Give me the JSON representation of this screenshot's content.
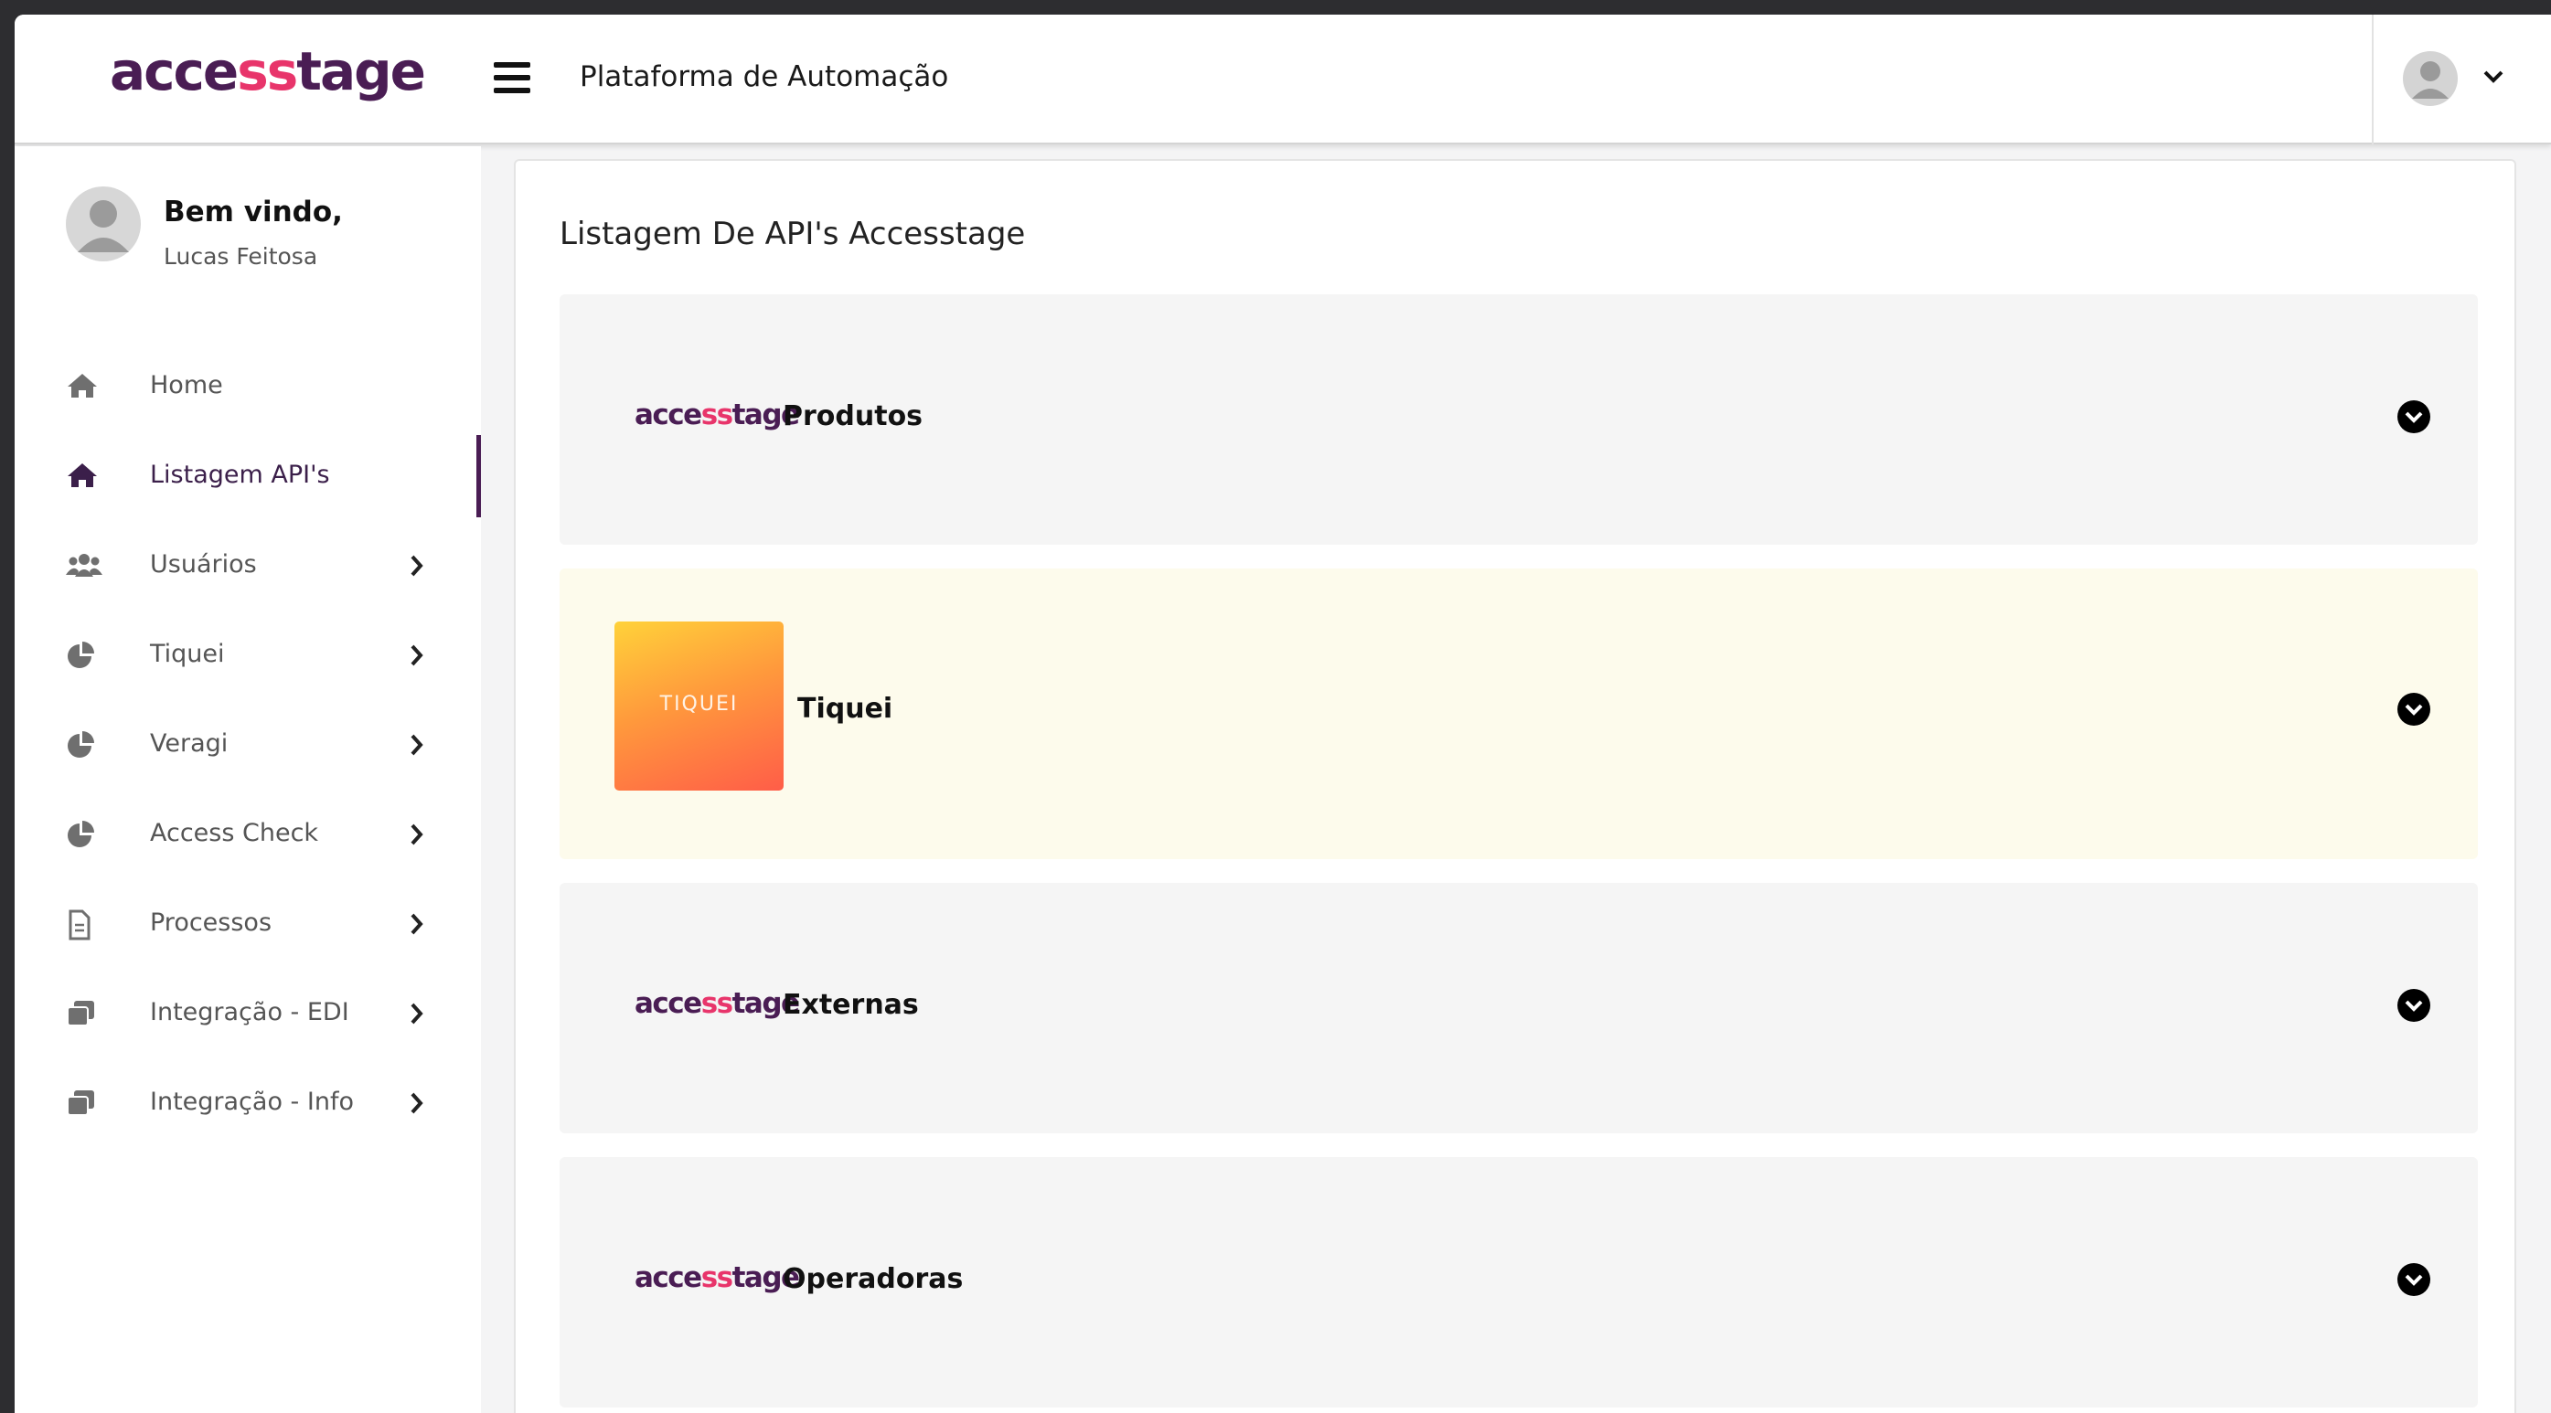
{
  "app": {
    "brand": {
      "pre": "acce",
      "mid": "ss",
      "post": "tage"
    },
    "title": "Plataforma de Automação",
    "colors": {
      "brand": "#4a1d54",
      "brand_accent": "#e8356b",
      "highlight": "#fdfbec"
    }
  },
  "header": {
    "menu_icon": "hamburger-icon",
    "user_icon": "user-avatar-icon",
    "caret_icon": "chevron-down-icon"
  },
  "sidebar": {
    "welcome": "Bem vindo,",
    "user_name": "Lucas Feitosa",
    "items": [
      {
        "label": "Home",
        "icon": "home-icon",
        "has_submenu": false,
        "active": false
      },
      {
        "label": "Listagem API's",
        "icon": "home-icon",
        "has_submenu": false,
        "active": true
      },
      {
        "label": "Usuários",
        "icon": "users-icon",
        "has_submenu": true,
        "active": false
      },
      {
        "label": "Tiquei",
        "icon": "pie-chart-icon",
        "has_submenu": true,
        "active": false
      },
      {
        "label": "Veragi",
        "icon": "pie-chart-icon",
        "has_submenu": true,
        "active": false
      },
      {
        "label": "Access Check",
        "icon": "pie-chart-icon",
        "has_submenu": true,
        "active": false
      },
      {
        "label": "Processos",
        "icon": "document-icon",
        "has_submenu": true,
        "active": false
      },
      {
        "label": "Integração - EDI",
        "icon": "copy-icon",
        "has_submenu": true,
        "active": false
      },
      {
        "label": "Integração - Info",
        "icon": "copy-icon",
        "has_submenu": true,
        "active": false
      }
    ]
  },
  "main": {
    "title": "Listagem De API's Accesstage",
    "cards": [
      {
        "title": "Produtos",
        "logo": "accesstage",
        "highlight": false
      },
      {
        "title": "Tiquei",
        "logo": "tiquei",
        "logo_text": "TIQUEI",
        "highlight": true
      },
      {
        "title": "Externas",
        "logo": "accesstage",
        "highlight": false
      },
      {
        "title": "Operadoras",
        "logo": "accesstage",
        "highlight": false
      }
    ]
  }
}
